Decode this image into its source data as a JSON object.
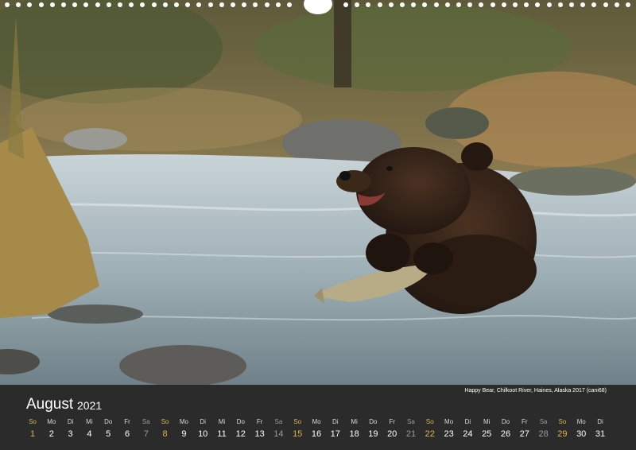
{
  "calendar": {
    "month": "August",
    "year": "2021",
    "caption": "Happy Bear, Chilkoot River, Haines, Alaska 2017 (cani68)",
    "days": [
      {
        "dow": "So",
        "num": "1",
        "kind": "sun"
      },
      {
        "dow": "Mo",
        "num": "2",
        "kind": "week"
      },
      {
        "dow": "Di",
        "num": "3",
        "kind": "week"
      },
      {
        "dow": "Mi",
        "num": "4",
        "kind": "week"
      },
      {
        "dow": "Do",
        "num": "5",
        "kind": "week"
      },
      {
        "dow": "Fr",
        "num": "6",
        "kind": "week"
      },
      {
        "dow": "Sa",
        "num": "7",
        "kind": "sat"
      },
      {
        "dow": "So",
        "num": "8",
        "kind": "sun"
      },
      {
        "dow": "Mo",
        "num": "9",
        "kind": "week"
      },
      {
        "dow": "Di",
        "num": "10",
        "kind": "week"
      },
      {
        "dow": "Mi",
        "num": "11",
        "kind": "week"
      },
      {
        "dow": "Do",
        "num": "12",
        "kind": "week"
      },
      {
        "dow": "Fr",
        "num": "13",
        "kind": "week"
      },
      {
        "dow": "Sa",
        "num": "14",
        "kind": "sat"
      },
      {
        "dow": "So",
        "num": "15",
        "kind": "sun"
      },
      {
        "dow": "Mo",
        "num": "16",
        "kind": "week"
      },
      {
        "dow": "Di",
        "num": "17",
        "kind": "week"
      },
      {
        "dow": "Mi",
        "num": "18",
        "kind": "week"
      },
      {
        "dow": "Do",
        "num": "19",
        "kind": "week"
      },
      {
        "dow": "Fr",
        "num": "20",
        "kind": "week"
      },
      {
        "dow": "Sa",
        "num": "21",
        "kind": "sat"
      },
      {
        "dow": "So",
        "num": "22",
        "kind": "sun"
      },
      {
        "dow": "Mo",
        "num": "23",
        "kind": "week"
      },
      {
        "dow": "Di",
        "num": "24",
        "kind": "week"
      },
      {
        "dow": "Mi",
        "num": "25",
        "kind": "week"
      },
      {
        "dow": "Do",
        "num": "26",
        "kind": "week"
      },
      {
        "dow": "Fr",
        "num": "27",
        "kind": "week"
      },
      {
        "dow": "Sa",
        "num": "28",
        "kind": "sat"
      },
      {
        "dow": "So",
        "num": "29",
        "kind": "sun"
      },
      {
        "dow": "Mo",
        "num": "30",
        "kind": "week"
      },
      {
        "dow": "Di",
        "num": "31",
        "kind": "week"
      }
    ]
  },
  "colors": {
    "band": "#2b2b2b",
    "sunday": "#d9b44a",
    "saturday": "#9a9a9a",
    "text": "#ffffff"
  }
}
